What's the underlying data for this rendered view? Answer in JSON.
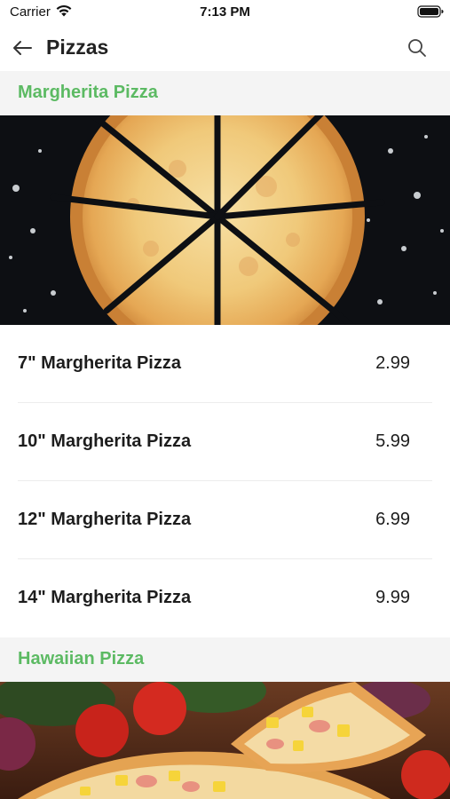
{
  "status_bar": {
    "carrier": "Carrier",
    "time": "7:13 PM"
  },
  "nav": {
    "title": "Pizzas",
    "back_icon": "arrow-left-icon",
    "search_icon": "search-icon"
  },
  "sections": [
    {
      "title": "Margherita Pizza",
      "image": "margherita-pizza-photo",
      "items": [
        {
          "name": "7\" Margherita Pizza",
          "price": "2.99"
        },
        {
          "name": "10\" Margherita Pizza",
          "price": "5.99"
        },
        {
          "name": "12\" Margherita Pizza",
          "price": "6.99"
        },
        {
          "name": "14\" Margherita Pizza",
          "price": "9.99"
        }
      ]
    },
    {
      "title": "Hawaiian Pizza",
      "image": "hawaiian-pizza-photo"
    }
  ],
  "colors": {
    "accent": "#5cba63",
    "section_bg": "#f4f4f4"
  }
}
